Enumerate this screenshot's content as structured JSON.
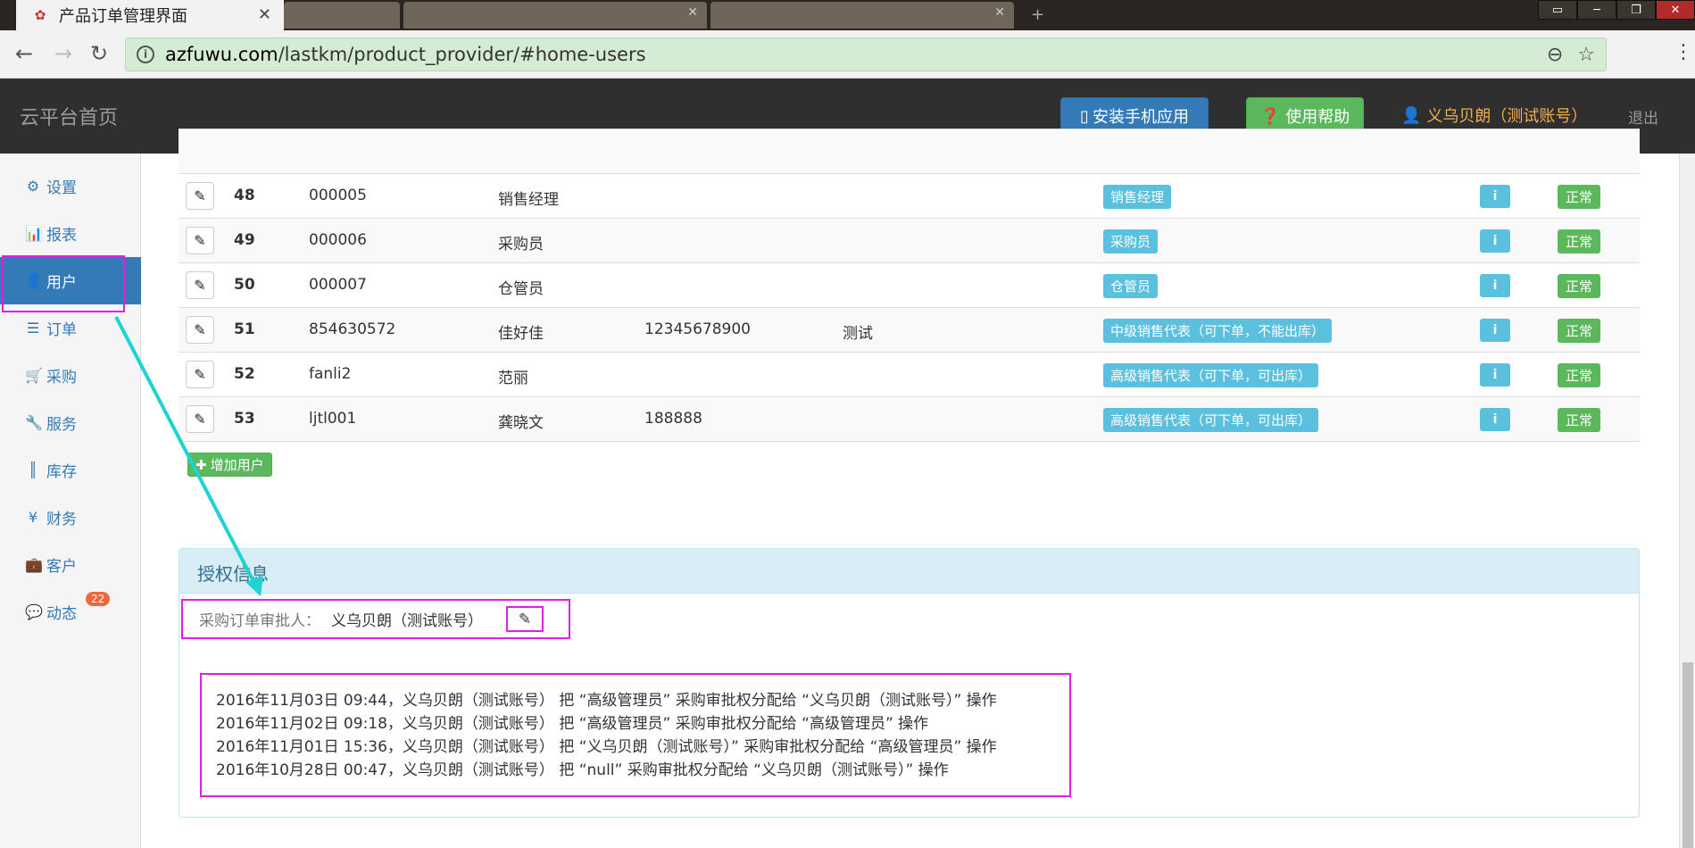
{
  "browser": {
    "active_tab_title": "产品订单管理界面",
    "url_host": "azfuwu.com",
    "url_path": "/lastkm/product_provider/#home-users"
  },
  "header": {
    "brand": "云平台首页",
    "install_app": "安装手机应用",
    "help": "使用帮助",
    "user": "义乌贝朗（测试账号）",
    "logout": "退出"
  },
  "sidebar": {
    "items": [
      {
        "label": "设置",
        "icon": "gear-icon",
        "glyph": "⚙"
      },
      {
        "label": "报表",
        "icon": "bar-chart-icon",
        "glyph": "▮"
      },
      {
        "label": "用户",
        "icon": "user-icon",
        "glyph": "👤"
      },
      {
        "label": "订单",
        "icon": "list-icon",
        "glyph": "☰"
      },
      {
        "label": "采购",
        "icon": "cart-icon",
        "glyph": "🛒"
      },
      {
        "label": "服务",
        "icon": "wrench-icon",
        "glyph": "🔧"
      },
      {
        "label": "库存",
        "icon": "barcode-icon",
        "glyph": "║"
      },
      {
        "label": "财务",
        "icon": "yen-icon",
        "glyph": "¥"
      },
      {
        "label": "客户",
        "icon": "briefcase-icon",
        "glyph": "💼"
      },
      {
        "label": "动态",
        "icon": "comment-icon",
        "glyph": "💬"
      }
    ],
    "badge": "22"
  },
  "table": {
    "rows": [
      {
        "id": "48",
        "account": "000005",
        "name": "销售经理",
        "phone": "",
        "note": "",
        "role": "销售经理",
        "status": "正常"
      },
      {
        "id": "49",
        "account": "000006",
        "name": "采购员",
        "phone": "",
        "note": "",
        "role": "采购员",
        "status": "正常"
      },
      {
        "id": "50",
        "account": "000007",
        "name": "仓管员",
        "phone": "",
        "note": "",
        "role": "仓管员",
        "status": "正常"
      },
      {
        "id": "51",
        "account": "854630572",
        "name": "佳好佳",
        "phone": "12345678900",
        "note": "测试",
        "role": "中级销售代表（可下单，不能出库）",
        "status": "正常"
      },
      {
        "id": "52",
        "account": "fanli2",
        "name": "范丽",
        "phone": "",
        "note": "",
        "role": "高级销售代表（可下单，可出库）",
        "status": "正常"
      },
      {
        "id": "53",
        "account": "ljtl001",
        "name": "龚晓文",
        "phone": "188888",
        "note": "",
        "role": "高级销售代表（可下单，可出库）",
        "status": "正常"
      }
    ]
  },
  "add_user": "增加用户",
  "auth": {
    "title": "授权信息",
    "approver_label": "采购订单审批人：",
    "approver_value": "义乌贝朗（测试账号）",
    "logs": [
      "2016年11月03日 09:44，义乌贝朗（测试账号） 把 “高级管理员” 采购审批权分配给 “义乌贝朗（测试账号）” 操作",
      "2016年11月02日 09:18，义乌贝朗（测试账号） 把 “高级管理员” 采购审批权分配给 “高级管理员” 操作",
      "2016年11月01日 15:36，义乌贝朗（测试账号） 把 “义乌贝朗（测试账号）” 采购审批权分配给 “高级管理员” 操作",
      "2016年10月28日 00:47，义乌贝朗（测试账号） 把 “null” 采购审批权分配给 “义乌贝朗（测试账号）” 操作"
    ]
  },
  "colors": {
    "primary": "#337ab7",
    "success": "#5cb85c",
    "info": "#5bc0de",
    "annotation": "#e020e0",
    "arrow": "#1fd3d3"
  }
}
